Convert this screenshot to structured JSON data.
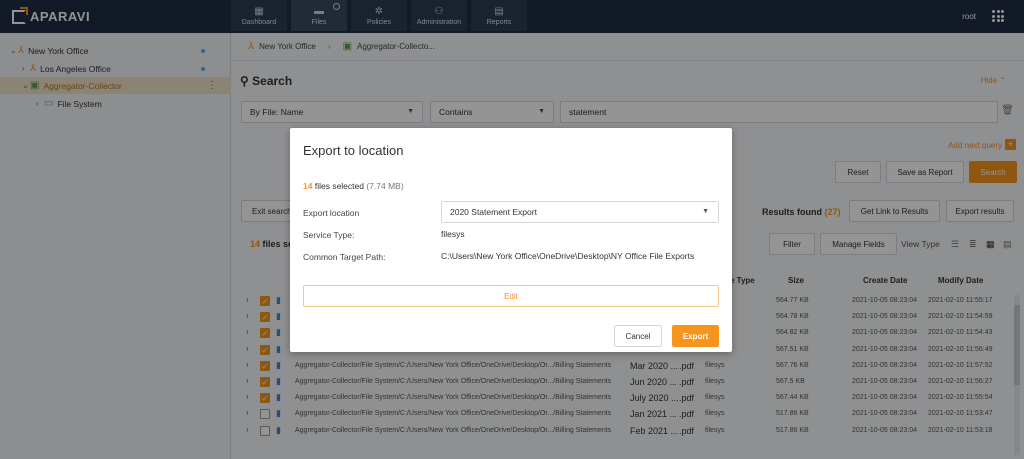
{
  "app": {
    "logo": "APARAVI",
    "user": "root"
  },
  "nav": [
    {
      "label": "Dashboard",
      "icon": "dashboard-icon"
    },
    {
      "label": "Files",
      "icon": "folder-icon"
    },
    {
      "label": "Policies",
      "icon": "gear-icon"
    },
    {
      "label": "Administration",
      "icon": "users-icon"
    },
    {
      "label": "Reports",
      "icon": "report-icon"
    }
  ],
  "sidebar": {
    "items": [
      {
        "label": "New York Office"
      },
      {
        "label": "Los Angeles Office"
      },
      {
        "label": "Aggregator-Collector"
      },
      {
        "label": "File System"
      }
    ]
  },
  "breadcrumb": {
    "first": "New York Office",
    "second": "Aggregator-Collecto..."
  },
  "search": {
    "title": "Search",
    "hide": "Hide",
    "field": "By File: Name",
    "operator": "Contains",
    "value": "statement",
    "add_query": "Add next query",
    "reset": "Reset",
    "save_report": "Save as Report",
    "search_btn": "Search"
  },
  "results": {
    "exit_search": "Exit search",
    "found_label": "Results found",
    "found_count": "(27)",
    "get_link": "Get Link to Results",
    "export_results": "Export results",
    "files_selected_count": "14",
    "files_selected_label": "files se",
    "filter": "Filter",
    "manage_fields": "Manage Fields",
    "view_type": "View Type",
    "columns": {
      "type": "e Type",
      "size": "Size",
      "create": "Create Date",
      "modify": "Modify Date"
    },
    "rows": [
      {
        "checked": true,
        "path": "",
        "name": "",
        "ext": "",
        "svc": "",
        "size": "564.77 KB",
        "create": "2021-10-05 08:23:04",
        "modify": "2021-02-10 11:55:17"
      },
      {
        "checked": true,
        "path": "",
        "name": "",
        "ext": "",
        "svc": "",
        "size": "564.78 KB",
        "create": "2021-10-05 08:23:04",
        "modify": "2021-02-10 11:54:59"
      },
      {
        "checked": true,
        "path": "",
        "name": "",
        "ext": "",
        "svc": "",
        "size": "564.82 KB",
        "create": "2021-10-05 08:23:04",
        "modify": "2021-02-10 11:54:43"
      },
      {
        "checked": true,
        "path": "",
        "name": "",
        "ext": "",
        "svc": "",
        "size": "567.51 KB",
        "create": "2021-10-05 08:23:04",
        "modify": "2021-02-10 11:56:49"
      },
      {
        "checked": true,
        "path": "Aggregator-Collector/File System/C:/Users/New York Office/OneDrive/Desktop/Or.../Billing Statements",
        "name": "Mar 2020 ...",
        "ext": ".pdf",
        "svc": "filesys",
        "size": "567.76 KB",
        "create": "2021-10-05 08:23:04",
        "modify": "2021-02-10 11:57:52"
      },
      {
        "checked": true,
        "path": "Aggregator-Collector/File System/C:/Users/New York Office/OneDrive/Desktop/Or.../Billing Statements",
        "name": "Jun 2020 ...",
        "ext": ".pdf",
        "svc": "filesys",
        "size": "567.5 KB",
        "create": "2021-10-05 08:23:04",
        "modify": "2021-02-10 11:56:27"
      },
      {
        "checked": true,
        "path": "Aggregator-Collector/File System/C:/Users/New York Office/OneDrive/Desktop/Or.../Billing Statements",
        "name": "July 2020 ...",
        "ext": ".pdf",
        "svc": "filesys",
        "size": "567.44 KB",
        "create": "2021-10-05 08:23:04",
        "modify": "2021-02-10 11:55:54"
      },
      {
        "checked": false,
        "path": "Aggregator-Collector/File System/C:/Users/New York Office/OneDrive/Desktop/Or.../Billing Statements",
        "name": "Jan 2021 ...",
        "ext": ".pdf",
        "svc": "filesys",
        "size": "517.86 KB",
        "create": "2021-10-05 08:23:04",
        "modify": "2021-02-10 11:53:47"
      },
      {
        "checked": false,
        "path": "Aggregator-Collector/File System/C:/Users/New York Office/OneDrive/Desktop/Or.../Billing Statements",
        "name": "Feb 2021 ...",
        "ext": ".pdf",
        "svc": "filesys",
        "size": "517.86 KB",
        "create": "2021-10-05 08:23:04",
        "modify": "2021-02-10 11:53:18"
      }
    ]
  },
  "modal": {
    "title": "Export to location",
    "files_count": "14",
    "files_label": "files selected",
    "files_size": "(7.74 MB)",
    "export_location_label": "Export location",
    "export_location_value": "2020 Statement Export",
    "service_type_label": "Service Type:",
    "service_type_value": "filesys",
    "target_path_label": "Common Target Path:",
    "target_path_value": "C:\\Users\\New York Office\\OneDrive\\Desktop\\NY Office File Exports",
    "edit": "Edit",
    "cancel": "Cancel",
    "export": "Export"
  },
  "colors": {
    "accent": "#f7941d",
    "topbar": "#1e2e42"
  }
}
